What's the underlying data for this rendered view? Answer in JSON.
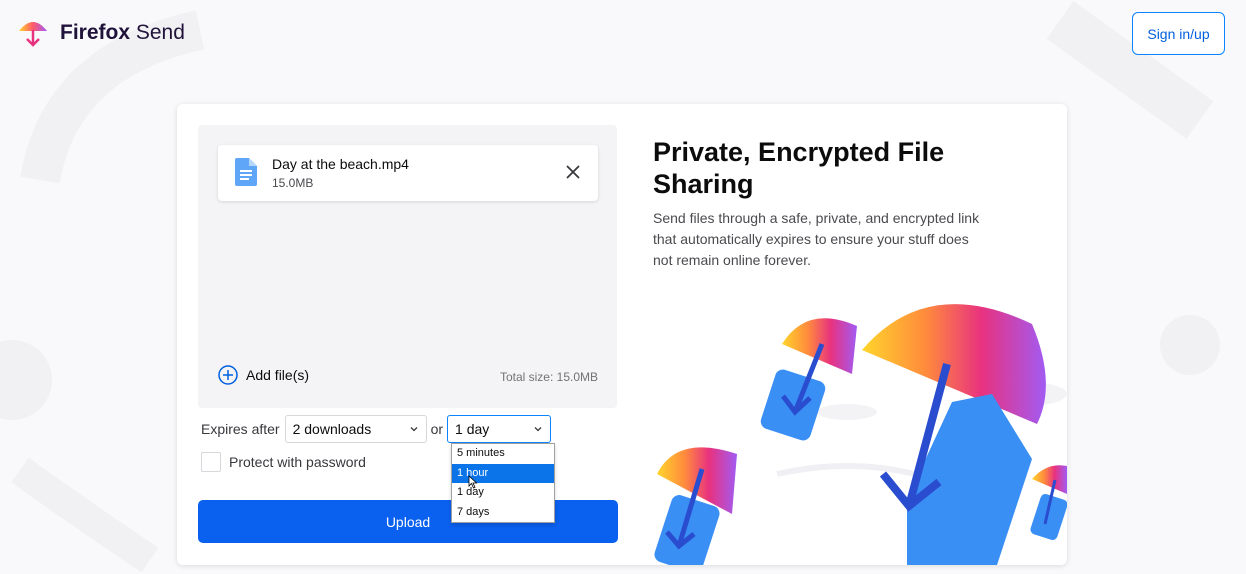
{
  "header": {
    "brand_bold": "Firefox",
    "brand_light": " Send",
    "signin_label": "Sign in/up"
  },
  "upload": {
    "file": {
      "name": "Day at the beach.mp4",
      "size": "15.0MB"
    },
    "add_files_label": "Add file(s)",
    "total_size": "Total size: 15.0MB"
  },
  "options": {
    "expires_label": "Expires after",
    "downloads_value": "2 downloads",
    "or_label": "or",
    "time_value": "1 day",
    "time_options": [
      "5 minutes",
      "1 hour",
      "1 day",
      "7 days"
    ],
    "highlighted_option": "1 hour",
    "password_label": "Protect with password",
    "password_checked": false
  },
  "upload_button_label": "Upload",
  "info": {
    "headline": "Private, Encrypted File Sharing",
    "description": "Send files through a safe, private, and encrypted link that automatically expires to ensure your stuff does not remain online forever."
  },
  "colors": {
    "accent": "#0a60ef",
    "link_blue": "#0060df",
    "file_icon_blue": "#5fa5f8",
    "umbrella_yellow": "#ffd52b",
    "umbrella_orange": "#ff8a3d",
    "umbrella_pink": "#e8327f",
    "umbrella_purple": "#a25bf3"
  }
}
